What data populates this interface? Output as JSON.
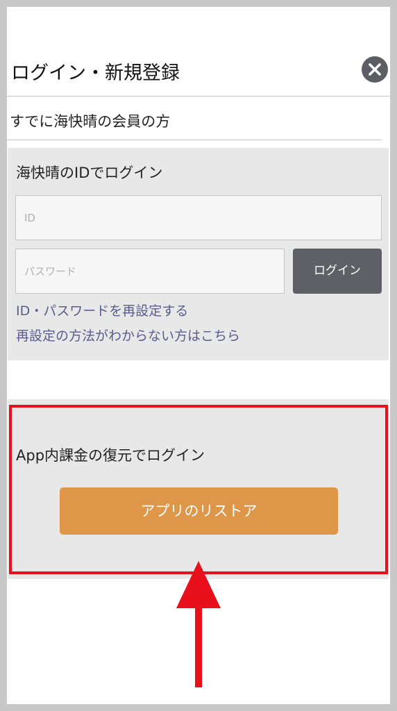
{
  "header": {
    "title": "ログイン・新規登録",
    "close_icon": "close-icon"
  },
  "member_section": {
    "heading": "すでに海快晴の会員の方"
  },
  "login_panel": {
    "heading": "海快晴のIDでログイン",
    "id_placeholder": "ID",
    "password_placeholder": "パスワード",
    "login_button": "ログイン",
    "reset_link": "ID・パスワードを再設定する",
    "help_link": "再設定の方法がわからない方はこちら"
  },
  "restore_panel": {
    "heading": "App内課金の復元でログイン",
    "restore_button": "アプリのリストア"
  },
  "annotations": {
    "highlight_color": "#e8101a",
    "arrow_icon": "arrow-up-icon"
  },
  "colors": {
    "accent_orange": "#de9749",
    "button_dark": "#5f6065",
    "link": "#5b5b8c",
    "panel_bg": "#e8e8e8"
  }
}
